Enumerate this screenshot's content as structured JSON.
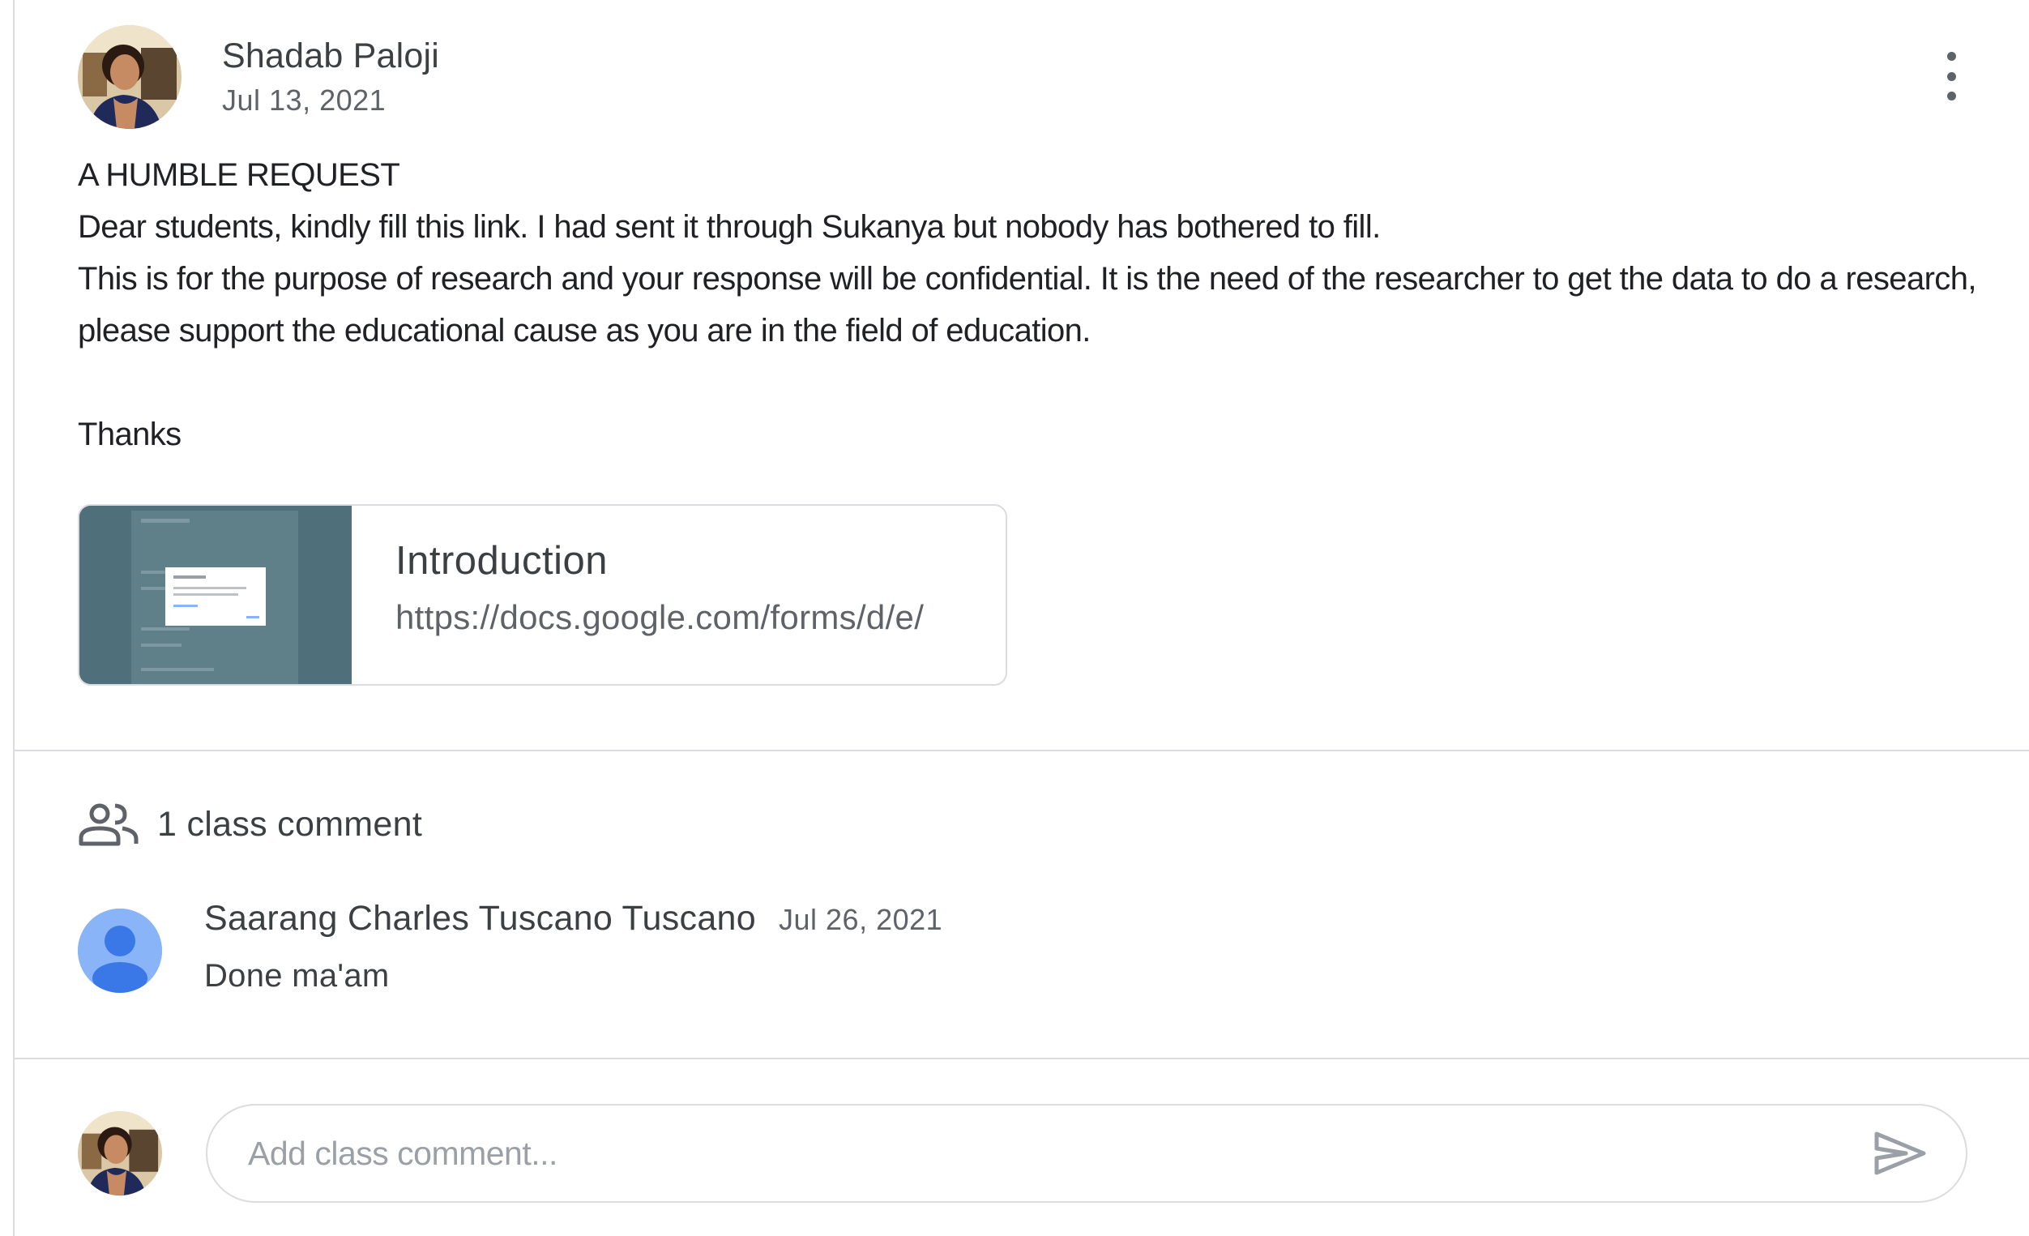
{
  "post": {
    "author": "Shadab Paloji",
    "date": "Jul 13, 2021",
    "body": {
      "line1": "A HUMBLE REQUEST",
      "line2": "Dear students, kindly fill this link. I had sent it through Sukanya but nobody has bothered to fill.",
      "line3": "This is for the purpose of research and your response will be confidential. It is the need of the researcher to get the data to do a research, please support the educational cause as you are in the field of education.",
      "line4": "Thanks"
    },
    "attachment": {
      "title": "Introduction",
      "url": "https://docs.google.com/forms/d/e/"
    }
  },
  "comments": {
    "count_label": "1 class comment",
    "items": [
      {
        "author": "Saarang Charles Tuscano Tuscano",
        "date": "Jul 26, 2021",
        "text": "Done ma'am"
      }
    ]
  },
  "add_comment": {
    "placeholder": "Add class comment..."
  },
  "icons": {
    "more": "more-vert-icon",
    "people": "people-icon",
    "send": "send-icon",
    "default_avatar": "default-avatar-icon"
  },
  "colors": {
    "avatar_default_bg": "#8ab4f8",
    "avatar_default_fg": "#3b78e7",
    "attachment_thumb_bg": "#4f707b"
  }
}
